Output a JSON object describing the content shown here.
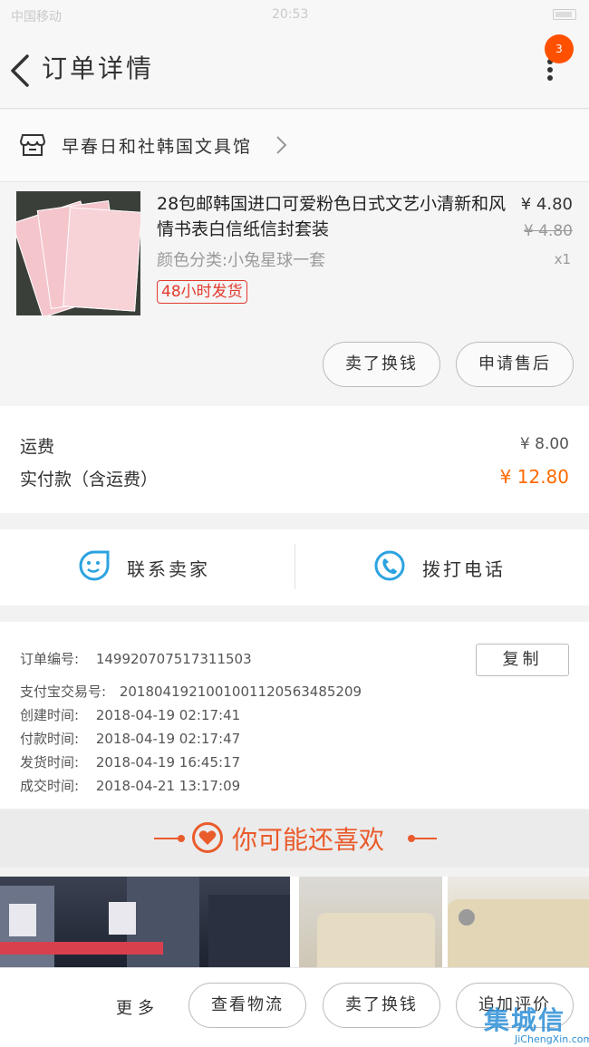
{
  "status_bar": {
    "carrier": "中国移动",
    "time": "20:53"
  },
  "header": {
    "title": "订单详情",
    "badge_count": "3"
  },
  "shop": {
    "name": "早春日和社韩国文具馆"
  },
  "product": {
    "title": "28包邮韩国进口可爱粉色日式文艺小清新和风情书表白信纸信封套装",
    "spec": "颜色分类:小兔星球一套",
    "tag": "48小时发货",
    "price": "¥ 4.80",
    "original_price": "¥ 4.80",
    "quantity": "x1",
    "buttons": {
      "resell": "卖了换钱",
      "after_sale": "申请售后"
    }
  },
  "fees": {
    "shipping_label": "运费",
    "shipping_value": "¥ 8.00",
    "total_label": "实付款（含运费）",
    "total_value": "¥ 12.80"
  },
  "contact": {
    "seller_label": "联系卖家",
    "call_label": "拨打电话"
  },
  "order_info": {
    "order_no": {
      "label": "订单编号:",
      "value": "149920707517311503"
    },
    "copy_label": "复制",
    "alipay_no": {
      "label": "支付宝交易号:",
      "value": "2018041921001001120563485209"
    },
    "created": {
      "label": "创建时间:",
      "value": "2018-04-19 02:17:41"
    },
    "paid": {
      "label": "付款时间:",
      "value": "2018-04-19 02:17:47"
    },
    "shipped": {
      "label": "发货时间:",
      "value": "2018-04-19 16:45:17"
    },
    "completed": {
      "label": "成交时间:",
      "value": "2018-04-21 13:17:09"
    }
  },
  "recommend": {
    "title": "你可能还喜欢"
  },
  "bottom_bar": {
    "more": "更多",
    "logistics": "查看物流",
    "resell": "卖了换钱",
    "review": "追加评价"
  },
  "watermark": {
    "logo": "集城信",
    "url": "JiChengXin.com"
  },
  "colors": {
    "accent": "#ff6a00",
    "tag_red": "#e23a2e",
    "contact_blue": "#2ba3e0",
    "recommend_orange": "#ea5b2c"
  },
  "icons": [
    "back-chevron-icon",
    "more-dots-icon",
    "shop-icon",
    "chevron-right-icon",
    "chat-face-icon",
    "phone-icon",
    "heart-icon"
  ]
}
